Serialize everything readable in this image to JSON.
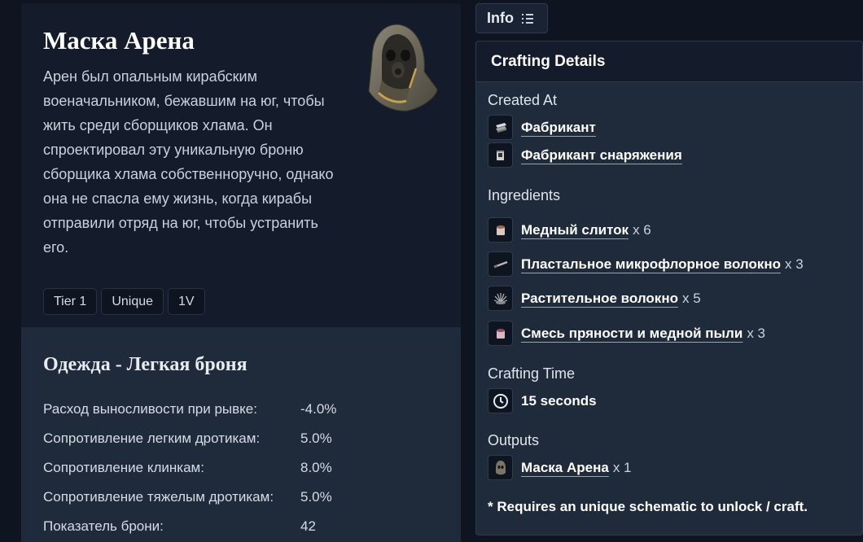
{
  "item": {
    "title": "Маска Арена",
    "description": "Арен был опальным кирабским военачальником, бежавшим на юг, чтобы жить среди сборщиков хлама. Он спроектировал эту уникальную броню сборщика хлама собственноручно, однако она не спасла ему жизнь, когда кирабы отправили отряд на юг, чтобы устранить его.",
    "tags": [
      "Tier 1",
      "Unique",
      "1V"
    ]
  },
  "category": {
    "title": "Одежда - Легкая броня"
  },
  "stats": [
    {
      "label": "Расход выносливости при рывке:",
      "value": "-4.0%"
    },
    {
      "label": "Сопротивление легким дротикам:",
      "value": "5.0%"
    },
    {
      "label": "Сопротивление клинкам:",
      "value": "8.0%"
    },
    {
      "label": "Сопротивление тяжелым дротикам:",
      "value": "5.0%"
    },
    {
      "label": "Показатель брони:",
      "value": "42"
    }
  ],
  "info_tab": {
    "label": "Info"
  },
  "crafting": {
    "header": "Crafting Details",
    "created_at_title": "Created At",
    "created_at": [
      {
        "name": "Фабрикант",
        "icon": "fabricator-icon"
      },
      {
        "name": "Фабрикант снаряжения",
        "icon": "gear-fabricator-icon"
      }
    ],
    "ingredients_title": "Ingredients",
    "ingredients": [
      {
        "name": "Медный слиток",
        "qty": "x 6",
        "icon": "copper-ingot-icon"
      },
      {
        "name": "Пластальное микрофлорное волокно",
        "qty": "x 3",
        "icon": "plasteel-fiber-icon"
      },
      {
        "name": "Растительное волокно",
        "qty": "x 5",
        "icon": "plant-fiber-icon"
      },
      {
        "name": "Смесь пряности и медной пыли",
        "qty": "x 3",
        "icon": "spice-copper-dust-icon"
      }
    ],
    "time_title": "Crafting Time",
    "time_value": "15 seconds",
    "outputs_title": "Outputs",
    "outputs": [
      {
        "name": "Маска Арена",
        "qty": "x 1",
        "icon": "aren-mask-icon"
      }
    ],
    "note": "* Requires an unique schematic to unlock / craft."
  }
}
